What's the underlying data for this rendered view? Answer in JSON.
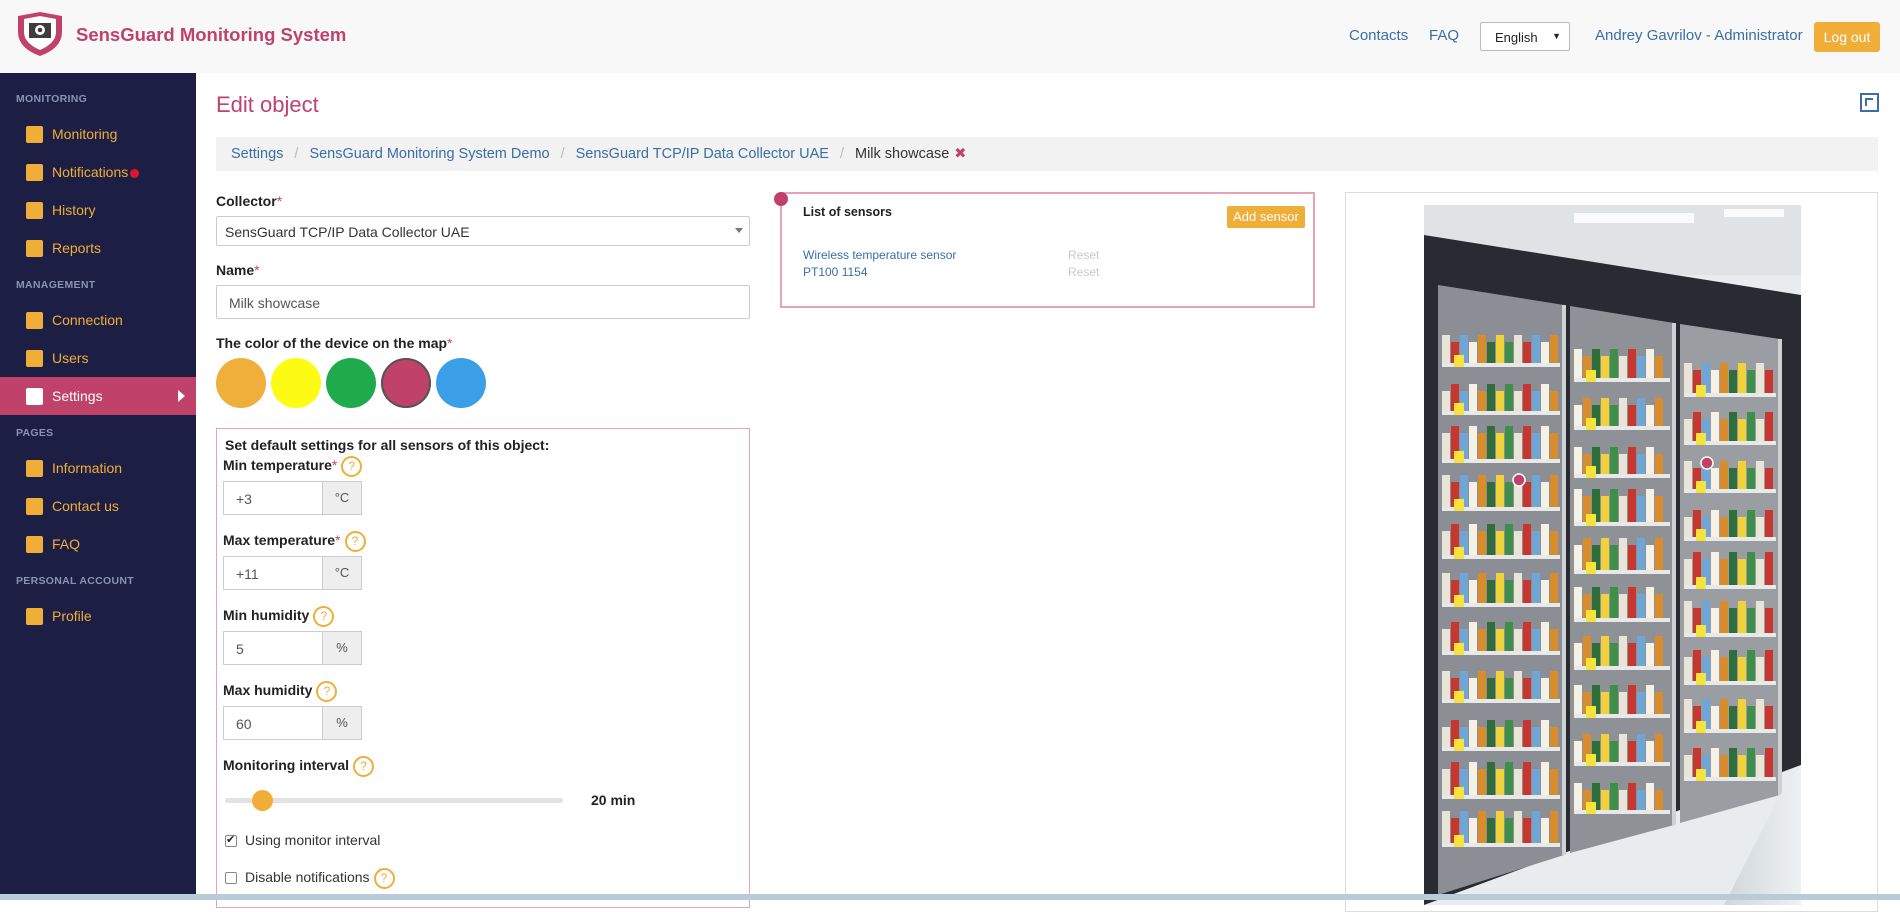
{
  "header": {
    "brand": "SensGuard Monitoring System",
    "links": {
      "contacts": "Contacts",
      "faq": "FAQ"
    },
    "language": "English",
    "user": "Andrey Gavrilov - Administrator",
    "logout": "Log out"
  },
  "sidebar": {
    "sections": {
      "monitoring": "MONITORING",
      "management": "MANAGEMENT",
      "pages": "PAGES",
      "personal": "PERSONAL ACCOUNT"
    },
    "items": {
      "monitoring": "Monitoring",
      "notifications": "Notifications",
      "history": "History",
      "reports": "Reports",
      "connection": "Connection",
      "users": "Users",
      "settings": "Settings",
      "information": "Information",
      "contact_us": "Contact us",
      "faq": "FAQ",
      "profile": "Profile"
    }
  },
  "page": {
    "title": "Edit object",
    "breadcrumb": [
      "Settings",
      "SensGuard Monitoring System Demo",
      "SensGuard TCP/IP Data Collector UAE",
      "Milk showcase"
    ]
  },
  "form": {
    "collector_label": "Collector",
    "collector_value": "SensGuard TCP/IP Data Collector UAE",
    "name_label": "Name",
    "name_value": "Milk showcase",
    "color_label": "The color of the device on the map",
    "colors": [
      "#efaf3a",
      "#fbfb13",
      "#1faa4b",
      "#c0426a",
      "#3a9fe6"
    ],
    "selected_color": "#c0426a",
    "required_mark": "*",
    "defaults": {
      "title": "Set default settings for all sensors of this object:",
      "help_mark": "?",
      "min_temp_label": "Min temperature",
      "min_temp": "+3",
      "max_temp_label": "Max temperature",
      "max_temp": "+11",
      "temp_unit": "°C",
      "min_hum_label": "Min humidity",
      "min_hum": "5",
      "max_hum_label": "Max humidity",
      "max_hum": "60",
      "hum_unit": "%",
      "interval_label": "Monitoring interval",
      "interval_value": "20 min",
      "interval_fraction": 0.11,
      "using_monitor_label": "Using monitor interval",
      "using_monitor_checked": true,
      "disable_notifications_label": "Disable notifications",
      "disable_notifications_checked": false
    }
  },
  "sensors": {
    "title": "List of sensors",
    "add_button": "Add sensor",
    "items": [
      {
        "name": "Wireless temperature sensor",
        "action": "Reset"
      },
      {
        "name": "PT100 1154",
        "action": "Reset"
      }
    ]
  },
  "colors": {
    "accent": "#c0426a",
    "orange": "#f0ae38",
    "sidebar_bg": "#1c1f43",
    "link": "#3a6ea5"
  }
}
